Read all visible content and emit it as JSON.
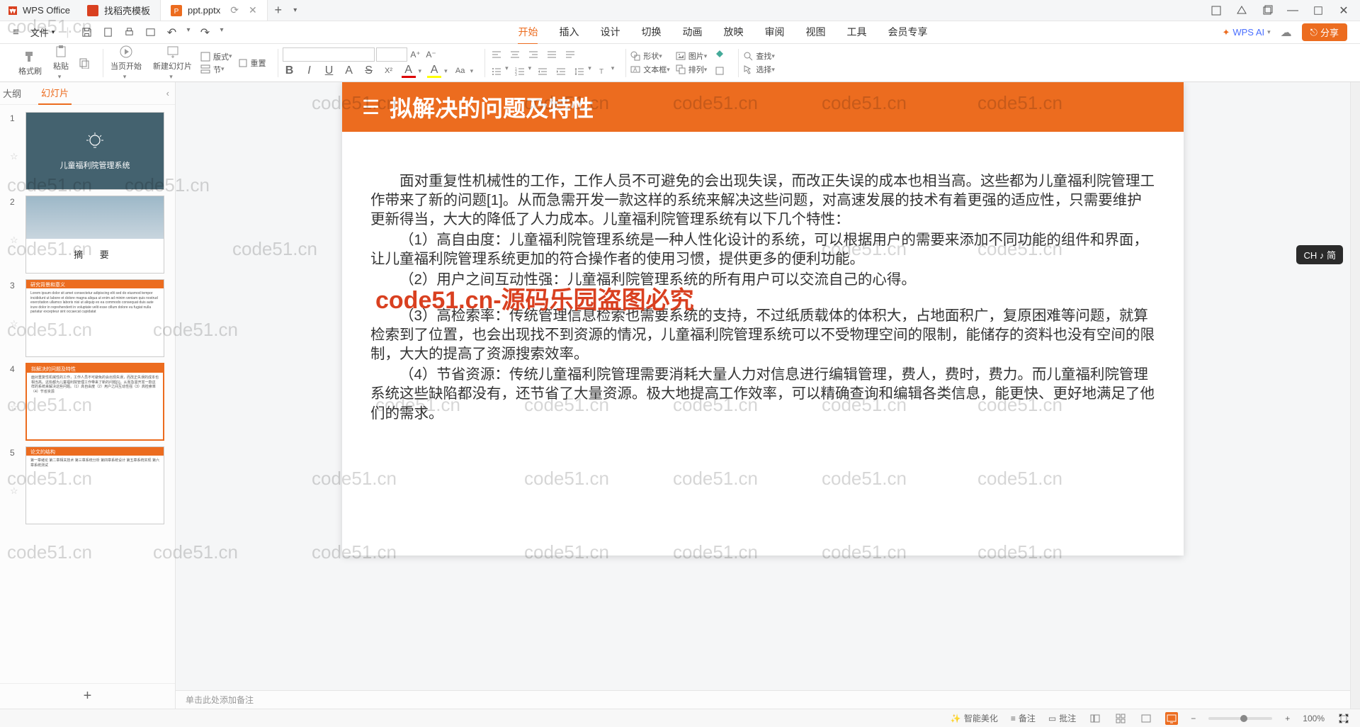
{
  "app_name": "WPS Office",
  "tabs": [
    {
      "label": "找稻壳模板",
      "icon": "#d94020"
    },
    {
      "label": "ppt.pptx",
      "icon": "#ec6c1f",
      "active": true
    }
  ],
  "menubar": {
    "file": "文件",
    "items": [
      "开始",
      "插入",
      "设计",
      "切换",
      "动画",
      "放映",
      "审阅",
      "视图",
      "工具",
      "会员专享"
    ],
    "active": "开始",
    "wps_ai": "WPS AI",
    "share": "分享"
  },
  "ribbon": {
    "format_painter": "格式刷",
    "paste": "粘贴",
    "from_begin": "当页开始",
    "new_slide": "新建幻灯片",
    "layout": "版式",
    "section": "节",
    "reset": "重置",
    "shape": "形状",
    "picture": "图片",
    "textbox": "文本框",
    "arrange": "排列",
    "find": "查找",
    "select": "选择"
  },
  "side_tabs": {
    "outline": "大纲",
    "slides": "幻灯片",
    "active": "幻灯片"
  },
  "thumbnails": [
    {
      "n": 1,
      "title": "儿童福利院管理系统"
    },
    {
      "n": 2,
      "title": "摘   要"
    },
    {
      "n": 3,
      "head": "研究背景和意义"
    },
    {
      "n": 4,
      "head": "拟解决的问题及特性",
      "active": true
    },
    {
      "n": 5,
      "head": "论文的结构"
    }
  ],
  "slide": {
    "title": "拟解决的问题及特性",
    "p1": "面对重复性机械性的工作，工作人员不可避免的会出现失误，而改正失误的成本也相当高。这些都为儿童福利院管理工作带来了新的问题[1]。从而急需开发一款这样的系统来解决这些问题，对高速发展的技术有着更强的适应性，只需要维护更新得当，大大的降低了人力成本。儿童福利院管理系统有以下几个特性：",
    "p2": "（1）高自由度：儿童福利院管理系统是一种人性化设计的系统，可以根据用户的需要来添加不同功能的组件和界面，让儿童福利院管理系统更加的符合操作者的使用习惯，提供更多的便利功能。",
    "p3": "（2）用户之间互动性强：儿童福利院管理系统的所有用户可以交流自己的心得。",
    "p4": "（3）高检索率：传统管理信息检索也需要系统的支持，不过纸质载体的体积大，占地面积广，复原困难等问题，就算检索到了位置，也会出现找不到资源的情况，儿童福利院管理系统可以不受物理空间的限制，能储存的资料也没有空间的限制，大大的提高了资源搜索效率。",
    "p5": "（4）节省资源：传统儿童福利院管理需要消耗大量人力对信息进行编辑管理，费人，费时，费力。而儿童福利院管理系统这些缺陷都没有，还节省了大量资源。极大地提高工作效率，可以精确查询和编辑各类信息，能更快、更好地满足了他们的需求。"
  },
  "notes_placeholder": "单击此处添加备注",
  "watermark": "code51.cn",
  "watermark_red": "code51.cn-源码乐园盗图必究",
  "lang_indicator": "CH ♪ 简",
  "status": {
    "smart_beautify": "智能美化",
    "notes": "备注",
    "comments": "批注",
    "zoom": "100%"
  }
}
